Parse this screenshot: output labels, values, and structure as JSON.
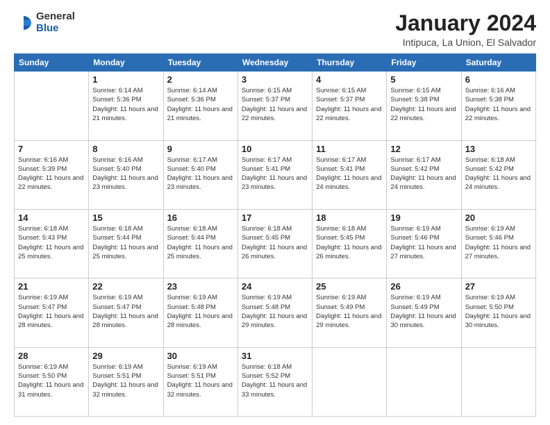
{
  "logo": {
    "general": "General",
    "blue": "Blue"
  },
  "header": {
    "month": "January 2024",
    "location": "Intipuca, La Union, El Salvador"
  },
  "weekdays": [
    "Sunday",
    "Monday",
    "Tuesday",
    "Wednesday",
    "Thursday",
    "Friday",
    "Saturday"
  ],
  "weeks": [
    [
      {
        "day": "",
        "sunrise": "",
        "sunset": "",
        "daylight": ""
      },
      {
        "day": "1",
        "sunrise": "6:14 AM",
        "sunset": "5:36 PM",
        "daylight": "11 hours and 21 minutes."
      },
      {
        "day": "2",
        "sunrise": "6:14 AM",
        "sunset": "5:36 PM",
        "daylight": "11 hours and 21 minutes."
      },
      {
        "day": "3",
        "sunrise": "6:15 AM",
        "sunset": "5:37 PM",
        "daylight": "11 hours and 22 minutes."
      },
      {
        "day": "4",
        "sunrise": "6:15 AM",
        "sunset": "5:37 PM",
        "daylight": "11 hours and 22 minutes."
      },
      {
        "day": "5",
        "sunrise": "6:15 AM",
        "sunset": "5:38 PM",
        "daylight": "11 hours and 22 minutes."
      },
      {
        "day": "6",
        "sunrise": "6:16 AM",
        "sunset": "5:38 PM",
        "daylight": "11 hours and 22 minutes."
      }
    ],
    [
      {
        "day": "7",
        "sunrise": "6:16 AM",
        "sunset": "5:39 PM",
        "daylight": "11 hours and 22 minutes."
      },
      {
        "day": "8",
        "sunrise": "6:16 AM",
        "sunset": "5:40 PM",
        "daylight": "11 hours and 23 minutes."
      },
      {
        "day": "9",
        "sunrise": "6:17 AM",
        "sunset": "5:40 PM",
        "daylight": "11 hours and 23 minutes."
      },
      {
        "day": "10",
        "sunrise": "6:17 AM",
        "sunset": "5:41 PM",
        "daylight": "11 hours and 23 minutes."
      },
      {
        "day": "11",
        "sunrise": "6:17 AM",
        "sunset": "5:41 PM",
        "daylight": "11 hours and 24 minutes."
      },
      {
        "day": "12",
        "sunrise": "6:17 AM",
        "sunset": "5:42 PM",
        "daylight": "11 hours and 24 minutes."
      },
      {
        "day": "13",
        "sunrise": "6:18 AM",
        "sunset": "5:42 PM",
        "daylight": "11 hours and 24 minutes."
      }
    ],
    [
      {
        "day": "14",
        "sunrise": "6:18 AM",
        "sunset": "5:43 PM",
        "daylight": "11 hours and 25 minutes."
      },
      {
        "day": "15",
        "sunrise": "6:18 AM",
        "sunset": "5:44 PM",
        "daylight": "11 hours and 25 minutes."
      },
      {
        "day": "16",
        "sunrise": "6:18 AM",
        "sunset": "5:44 PM",
        "daylight": "11 hours and 25 minutes."
      },
      {
        "day": "17",
        "sunrise": "6:18 AM",
        "sunset": "5:45 PM",
        "daylight": "11 hours and 26 minutes."
      },
      {
        "day": "18",
        "sunrise": "6:18 AM",
        "sunset": "5:45 PM",
        "daylight": "11 hours and 26 minutes."
      },
      {
        "day": "19",
        "sunrise": "6:19 AM",
        "sunset": "5:46 PM",
        "daylight": "11 hours and 27 minutes."
      },
      {
        "day": "20",
        "sunrise": "6:19 AM",
        "sunset": "5:46 PM",
        "daylight": "11 hours and 27 minutes."
      }
    ],
    [
      {
        "day": "21",
        "sunrise": "6:19 AM",
        "sunset": "5:47 PM",
        "daylight": "11 hours and 28 minutes."
      },
      {
        "day": "22",
        "sunrise": "6:19 AM",
        "sunset": "5:47 PM",
        "daylight": "11 hours and 28 minutes."
      },
      {
        "day": "23",
        "sunrise": "6:19 AM",
        "sunset": "5:48 PM",
        "daylight": "11 hours and 28 minutes."
      },
      {
        "day": "24",
        "sunrise": "6:19 AM",
        "sunset": "5:48 PM",
        "daylight": "11 hours and 29 minutes."
      },
      {
        "day": "25",
        "sunrise": "6:19 AM",
        "sunset": "5:49 PM",
        "daylight": "11 hours and 29 minutes."
      },
      {
        "day": "26",
        "sunrise": "6:19 AM",
        "sunset": "5:49 PM",
        "daylight": "11 hours and 30 minutes."
      },
      {
        "day": "27",
        "sunrise": "6:19 AM",
        "sunset": "5:50 PM",
        "daylight": "11 hours and 30 minutes."
      }
    ],
    [
      {
        "day": "28",
        "sunrise": "6:19 AM",
        "sunset": "5:50 PM",
        "daylight": "11 hours and 31 minutes."
      },
      {
        "day": "29",
        "sunrise": "6:19 AM",
        "sunset": "5:51 PM",
        "daylight": "11 hours and 32 minutes."
      },
      {
        "day": "30",
        "sunrise": "6:19 AM",
        "sunset": "5:51 PM",
        "daylight": "11 hours and 32 minutes."
      },
      {
        "day": "31",
        "sunrise": "6:18 AM",
        "sunset": "5:52 PM",
        "daylight": "11 hours and 33 minutes."
      },
      {
        "day": "",
        "sunrise": "",
        "sunset": "",
        "daylight": ""
      },
      {
        "day": "",
        "sunrise": "",
        "sunset": "",
        "daylight": ""
      },
      {
        "day": "",
        "sunrise": "",
        "sunset": "",
        "daylight": ""
      }
    ]
  ],
  "labels": {
    "sunrise_prefix": "Sunrise: ",
    "sunset_prefix": "Sunset: ",
    "daylight_prefix": "Daylight: "
  }
}
